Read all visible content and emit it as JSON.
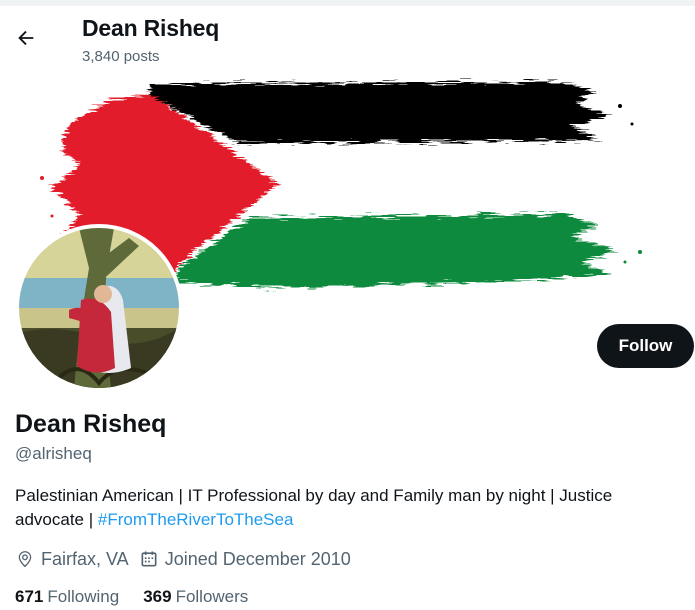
{
  "header": {
    "title": "Dean Risheq",
    "posts_count": "3,840 posts"
  },
  "profile": {
    "name": "Dean Risheq",
    "handle": "@alrisheq",
    "follow_label": "Follow",
    "bio_text": "Palestinian American | IT Professional by day and Family man by night | Justice advocate | ",
    "bio_hashtag": "#FromTheRiverToTheSea",
    "location": "Fairfax, VA",
    "joined": "Joined December 2010",
    "following_count": "671",
    "following_label": "Following",
    "followers_count": "369",
    "followers_label": "Followers"
  },
  "icons": {
    "back": "arrow-left-icon",
    "location": "location-pin-icon",
    "calendar": "calendar-icon"
  },
  "colors": {
    "text": "#0f1419",
    "muted": "#536471",
    "link": "#1d9bf0",
    "button": "#0f1419",
    "flag_black": "#000000",
    "flag_green": "#0b8a3e",
    "flag_red": "#e21b2b"
  }
}
